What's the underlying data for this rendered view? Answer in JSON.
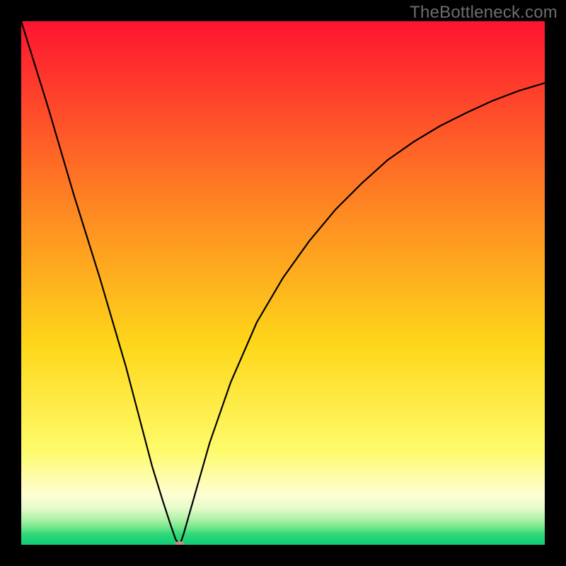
{
  "watermark": "TheBottleneck.com",
  "chart_data": {
    "type": "line",
    "title": "",
    "xlabel": "",
    "ylabel": "",
    "xlim": [
      0,
      1
    ],
    "ylim": [
      0,
      1
    ],
    "x": [
      0.0,
      0.05,
      0.1,
      0.15,
      0.2,
      0.25,
      0.27,
      0.285,
      0.295,
      0.303,
      0.31,
      0.33,
      0.36,
      0.4,
      0.45,
      0.5,
      0.55,
      0.6,
      0.65,
      0.7,
      0.75,
      0.8,
      0.85,
      0.9,
      0.95,
      1.0
    ],
    "values": [
      1.0,
      0.84,
      0.67,
      0.51,
      0.34,
      0.15,
      0.085,
      0.039,
      0.01,
      0.0,
      0.02,
      0.09,
      0.195,
      0.31,
      0.425,
      0.51,
      0.58,
      0.64,
      0.69,
      0.735,
      0.77,
      0.8,
      0.825,
      0.848,
      0.867,
      0.882
    ],
    "background_gradient": {
      "stops": [
        {
          "offset": 0.0,
          "color": "#fe1430"
        },
        {
          "offset": 0.38,
          "color": "#fe8e22"
        },
        {
          "offset": 0.62,
          "color": "#fed71a"
        },
        {
          "offset": 0.82,
          "color": "#fefb6b"
        },
        {
          "offset": 0.905,
          "color": "#fefed3"
        },
        {
          "offset": 0.93,
          "color": "#e5fbca"
        },
        {
          "offset": 0.95,
          "color": "#b3f2ab"
        },
        {
          "offset": 0.965,
          "color": "#7ae88f"
        },
        {
          "offset": 0.98,
          "color": "#2fd878"
        },
        {
          "offset": 1.0,
          "color": "#0ecd76"
        }
      ]
    },
    "marker": {
      "x": 0.303,
      "y": 0.0,
      "color": "#c98b86"
    }
  }
}
